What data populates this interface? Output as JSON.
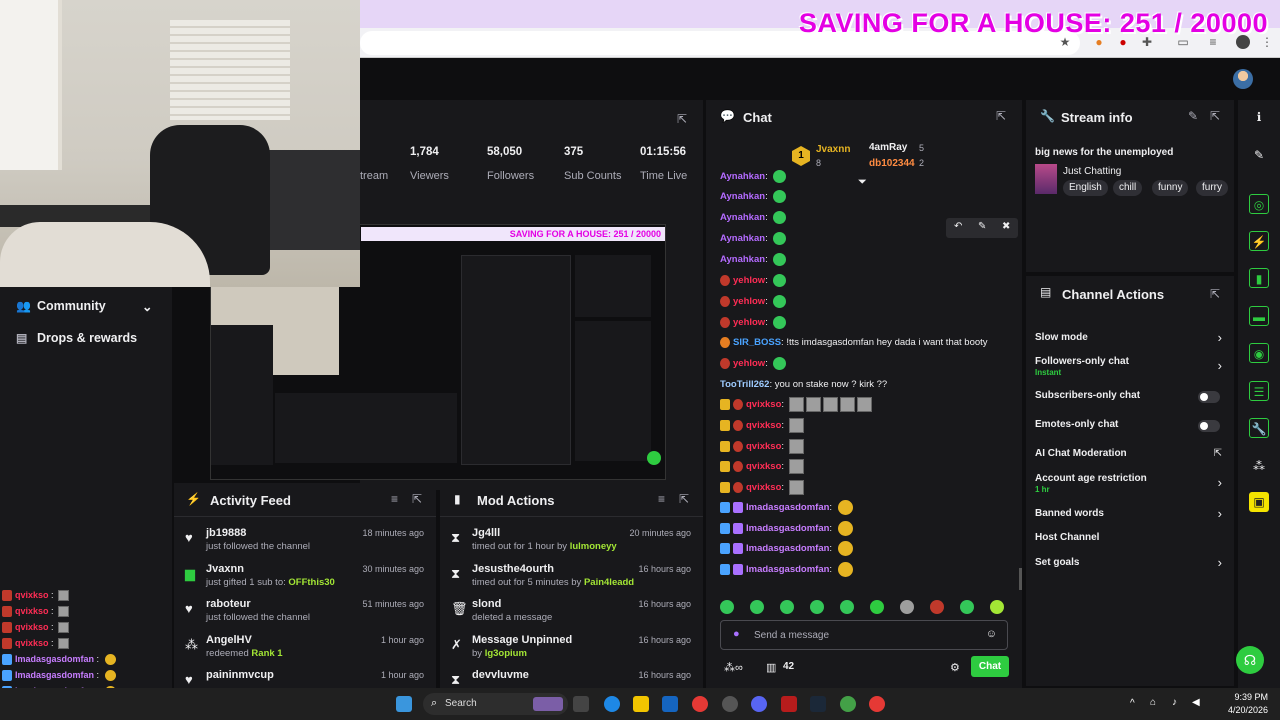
{
  "goal_overlay": "SAVING FOR A HOUSE: 251 / 20000",
  "leftnav": {
    "items": [
      {
        "label": "Community",
        "icon": "community-icon"
      },
      {
        "label": "Drops & rewards",
        "icon": "drops-icon"
      }
    ]
  },
  "stats": {
    "partial_label": "tream",
    "items": [
      {
        "value": "1,784",
        "label": "Viewers"
      },
      {
        "value": "58,050",
        "label": "Followers"
      },
      {
        "value": "375",
        "label": "Sub Counts"
      },
      {
        "value": "01:15:56",
        "label": "Time Live"
      }
    ]
  },
  "preview": {
    "goal": "SAVING FOR A HOUSE: 251 / 20000"
  },
  "activity": {
    "title": "Activity Feed",
    "rows": [
      {
        "name": "jb19888",
        "sub": "just followed the channel",
        "time": "18 minutes ago",
        "icon": "heart-icon"
      },
      {
        "name": "Jvaxnn",
        "sub": "just gifted 1 sub to: ",
        "highlight": "OFFthis30",
        "time": "30 minutes ago",
        "icon": "gift-icon"
      },
      {
        "name": "raboteur",
        "sub": "just followed the channel",
        "time": "51 minutes ago",
        "icon": "heart-icon"
      },
      {
        "name": "AngelHV",
        "sub": "redeemed ",
        "highlight": "Rank 1",
        "time": "1 hour ago",
        "icon": "redeem-icon"
      },
      {
        "name": "paininmvcup",
        "sub": "",
        "time": "1 hour ago",
        "icon": "heart-icon"
      }
    ]
  },
  "modactions": {
    "title": "Mod Actions",
    "rows": [
      {
        "name": "Jg4lll",
        "sub": "timed out for 1 hour by ",
        "highlight": "lulmoneyy",
        "time": "20 minutes ago",
        "icon": "timeout-icon"
      },
      {
        "name": "Jesusthe4ourth",
        "sub": "timed out for 5 minutes by ",
        "highlight": "Pain4leadd",
        "time": "16 hours ago",
        "icon": "timeout-icon"
      },
      {
        "name": "slond",
        "sub": "deleted a message",
        "time": "16 hours ago",
        "icon": "trash-icon"
      },
      {
        "name": "Message Unpinned",
        "sub": "by ",
        "highlight": "lg3opium",
        "time": "16 hours ago",
        "icon": "unpin-icon"
      },
      {
        "name": "devvluvme",
        "sub": "",
        "time": "16 hours ago",
        "icon": "timeout-icon"
      }
    ]
  },
  "chat": {
    "title": "Chat",
    "leaderboard": {
      "rank1": "1",
      "first": {
        "name": "Jvaxnn",
        "count": "8"
      },
      "second": {
        "name": "4amRay",
        "count": "5"
      },
      "third": {
        "name": "db102344",
        "count": "2"
      }
    },
    "messages": [
      {
        "user": "Aynahkan",
        "color": "#b46bff",
        "text": "",
        "emotes": 1
      },
      {
        "user": "Aynahkan",
        "color": "#b46bff",
        "text": "",
        "emotes": 1
      },
      {
        "user": "Aynahkan",
        "color": "#b46bff",
        "text": "",
        "emotes": 1
      },
      {
        "user": "Aynahkan",
        "color": "#b46bff",
        "text": "",
        "emotes": 1
      },
      {
        "user": "Aynahkan",
        "color": "#b46bff",
        "text": "",
        "emotes": 1
      },
      {
        "user": "yehlow",
        "color": "#ff2d55",
        "text": "",
        "emotes": 1
      },
      {
        "user": "yehlow",
        "color": "#ff2d55",
        "text": "",
        "emotes": 1
      },
      {
        "user": "yehlow",
        "color": "#ff2d55",
        "text": "",
        "emotes": 1
      },
      {
        "user": "SIR_BOSS",
        "color": "#4aa3ff",
        "text": "!tts imdasgasdomfan hey dada i want that booty",
        "emotes": 0
      },
      {
        "user": "yehlow",
        "color": "#ff2d55",
        "text": "",
        "emotes": 1
      },
      {
        "user": "TooTrill262",
        "color": "#9ecbff",
        "text": "you on stake now ? kirk ??",
        "emotes": 0
      },
      {
        "user": "qvixkso",
        "color": "#ff2d55",
        "text": "",
        "emotes": 5
      },
      {
        "user": "qvixkso",
        "color": "#ff2d55",
        "text": "",
        "emotes": 1
      },
      {
        "user": "qvixkso",
        "color": "#ff2d55",
        "text": "",
        "emotes": 1
      },
      {
        "user": "qvixkso",
        "color": "#ff2d55",
        "text": "",
        "emotes": 1
      },
      {
        "user": "qvixkso",
        "color": "#ff2d55",
        "text": "",
        "emotes": 1
      },
      {
        "user": "Imadasgasdomfan",
        "color": "#c77dff",
        "text": "",
        "emotes": 1
      },
      {
        "user": "Imadasgasdomfan",
        "color": "#c77dff",
        "text": "",
        "emotes": 1
      },
      {
        "user": "Imadasgasdomfan",
        "color": "#c77dff",
        "text": "",
        "emotes": 1
      },
      {
        "user": "Imadasgasdomfan",
        "color": "#c77dff",
        "text": "",
        "emotes": 1
      }
    ],
    "input_placeholder": "Send a message",
    "viewer_count": "42",
    "send_label": "Chat"
  },
  "streaminfo": {
    "title": "Stream info",
    "stream_title": "big news for the unemployed",
    "category": "Just Chatting",
    "tags": [
      "English",
      "chill",
      "funny",
      "furry"
    ]
  },
  "channelactions": {
    "title": "Channel Actions",
    "rows": [
      {
        "label": "Slow mode",
        "control": "chevron"
      },
      {
        "label": "Followers-only chat",
        "sub": "Instant",
        "control": "chevron"
      },
      {
        "label": "Subscribers-only chat",
        "control": "toggle"
      },
      {
        "label": "Emotes-only chat",
        "control": "toggle"
      },
      {
        "label": "AI Chat Moderation",
        "control": "external"
      },
      {
        "label": "Account age restriction",
        "sub": "1 hr",
        "control": "chevron"
      },
      {
        "label": "Banned words",
        "control": "chevron"
      },
      {
        "label": "Host Channel",
        "control": "none"
      },
      {
        "label": "Set goals",
        "control": "chevron"
      }
    ]
  },
  "sidechat": [
    {
      "user": "qvixkso",
      "color": "#ff2d55"
    },
    {
      "user": "qvixkso",
      "color": "#ff2d55"
    },
    {
      "user": "qvixkso",
      "color": "#ff2d55"
    },
    {
      "user": "qvixkso",
      "color": "#ff2d55"
    },
    {
      "user": "Imadasgasdomfan",
      "color": "#c77dff"
    },
    {
      "user": "Imadasgasdomfan",
      "color": "#c77dff"
    },
    {
      "user": "Imadasgasdomfan",
      "color": "#c77dff"
    },
    {
      "user": "Imadasgasdomfan",
      "color": "#c77dff"
    }
  ],
  "taskbar": {
    "search_label": "Search",
    "time": "9:39 PM",
    "date": "4/20/2026"
  }
}
